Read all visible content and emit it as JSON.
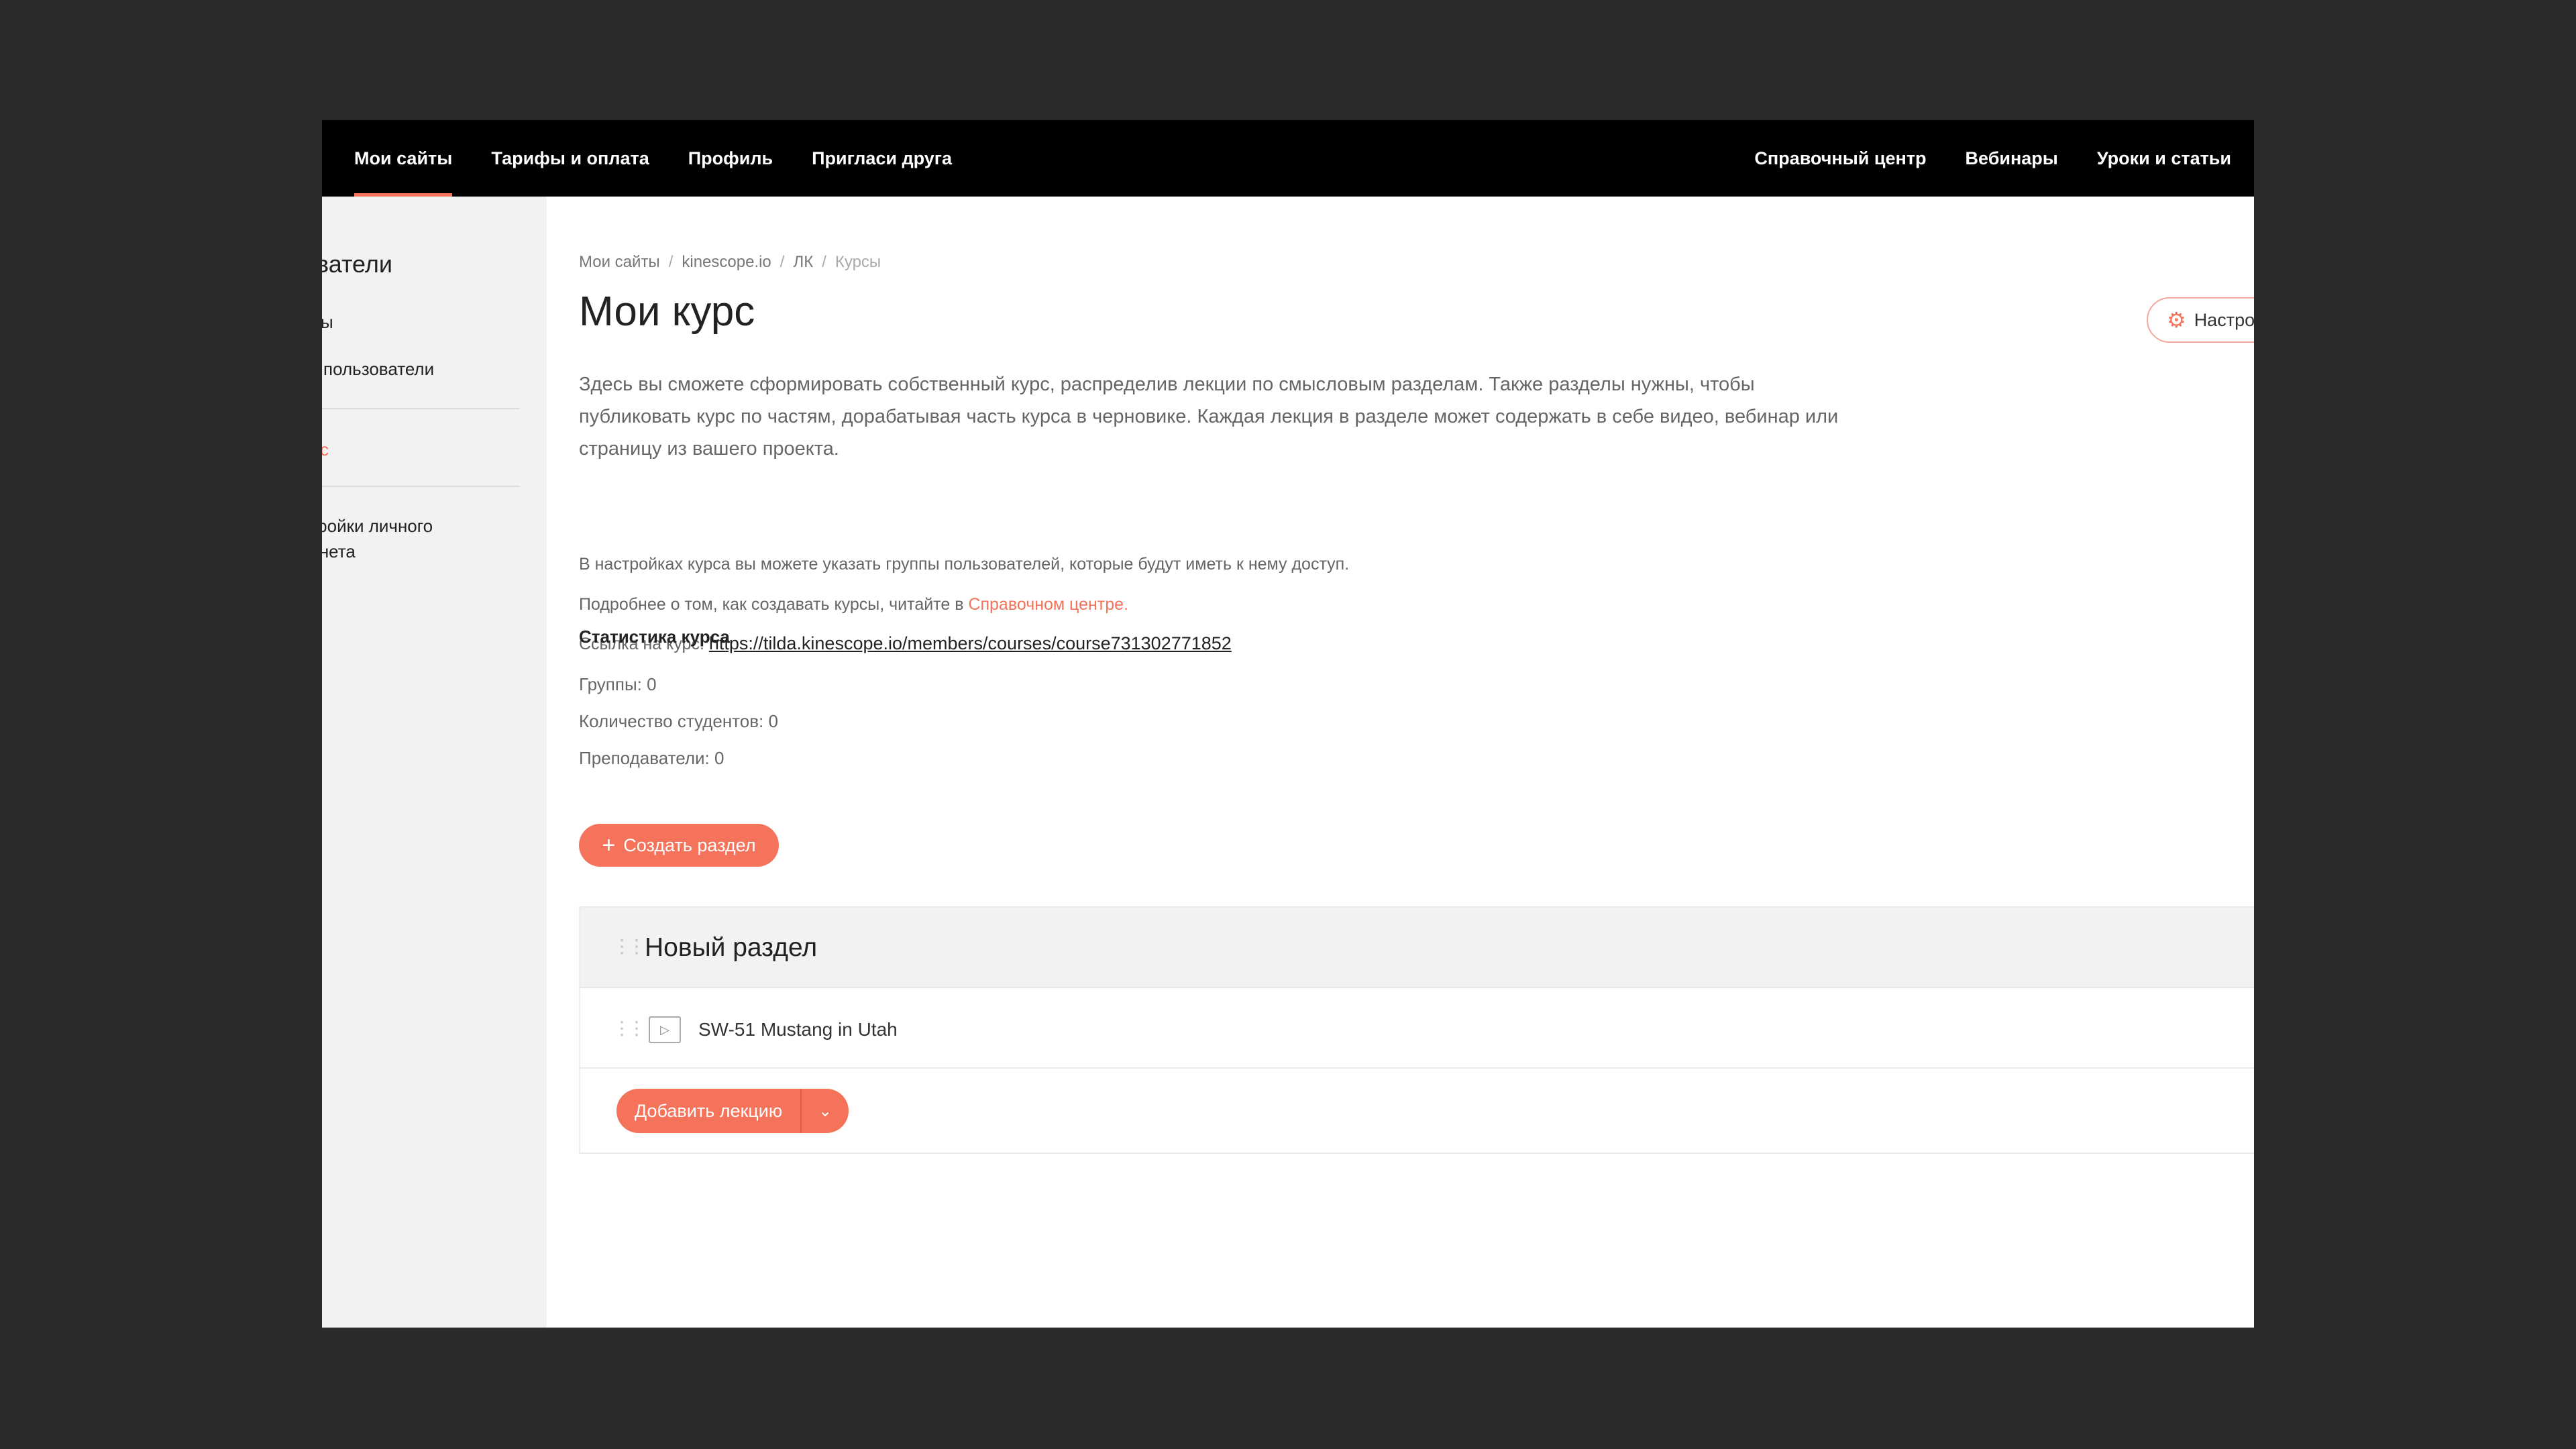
{
  "topnav": {
    "left": [
      "Мои сайты",
      "Тарифы и оплата",
      "Профиль",
      "Пригласи друга"
    ],
    "right": [
      "Справочный центр",
      "Вебинары",
      "Уроки и статьи"
    ]
  },
  "sidebar": {
    "title": "Пользователи",
    "items": [
      "Группы",
      "Все пользователи",
      "Мой курс",
      "Настройки личного",
      "кабинета"
    ]
  },
  "breadcrumb": [
    "Мои сайты",
    "kinescope.io",
    "ЛК",
    "Курсы"
  ],
  "page_title": "Мои курс",
  "settings_button": "Настройки",
  "description": "Здесь вы сможете сформировать собственный курс, распределив лекции по смысловым разделам. Также разделы нужны, чтобы публиковать курс по частям, дорабатывая часть курса в черновике. Каждая лекция в разделе может содержать в себе видео, вебинар или страницу из вашего проекта.",
  "note_groups": "В настройках курса вы можете указать группы пользователей, которые будут иметь к нему доступ.",
  "note_help_prefix": "Подробнее о том, как создавать курсы, читайте в ",
  "note_help_link": "Справочном центре.",
  "note_link_prefix": "Ссылка на курс: ",
  "note_link_url": "https://tilda.kinescope.io/members/courses/course731302771852",
  "stats": {
    "title": "Статистика курса",
    "groups": "Группы:  0",
    "students": "Количество студентов: 0",
    "teachers": "Преподаватели:  0"
  },
  "create_section_button": "Создать раздел",
  "section": {
    "title": "Новый раздел",
    "lecture": "SW-51 Mustang in Utah",
    "add_lecture_button": "Добавить лекцию"
  },
  "icons": {
    "gear": "gear-icon",
    "plus": "plus-icon",
    "drag": "drag-handle-icon",
    "play": "video-icon",
    "caret": "chevron-down-icon"
  },
  "colors": {
    "accent": "#f4735a",
    "nav_bg": "#000000",
    "sidebar_bg": "#f2f2f2"
  }
}
